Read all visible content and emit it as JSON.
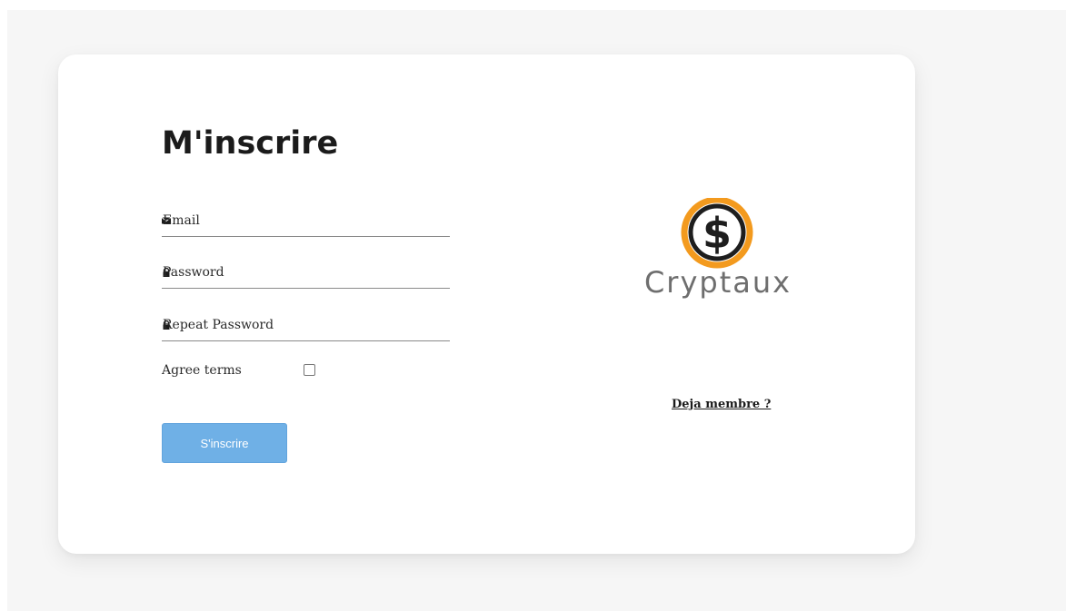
{
  "form": {
    "title": "M'inscrire",
    "email_label": "Email",
    "password_label": "Password",
    "repeat_password_label": "Repeat Password",
    "agree_label": "Agree terms",
    "agree_checked": false,
    "submit_label": "S'inscrire"
  },
  "brand": {
    "logo_text": "Cryptaux",
    "logo_symbol": "$",
    "logo_ring_color": "#f39a1e",
    "logo_text_color": "#6e6e6e"
  },
  "links": {
    "already_member": "Deja membre ?"
  },
  "icons": {
    "email": "envelope-icon",
    "password": "lock-icon",
    "repeat_password": "lock-icon"
  },
  "colors": {
    "background": "#f6f6f6",
    "card": "#ffffff",
    "button": "#6fb0e6",
    "text": "#1b1b1b"
  }
}
